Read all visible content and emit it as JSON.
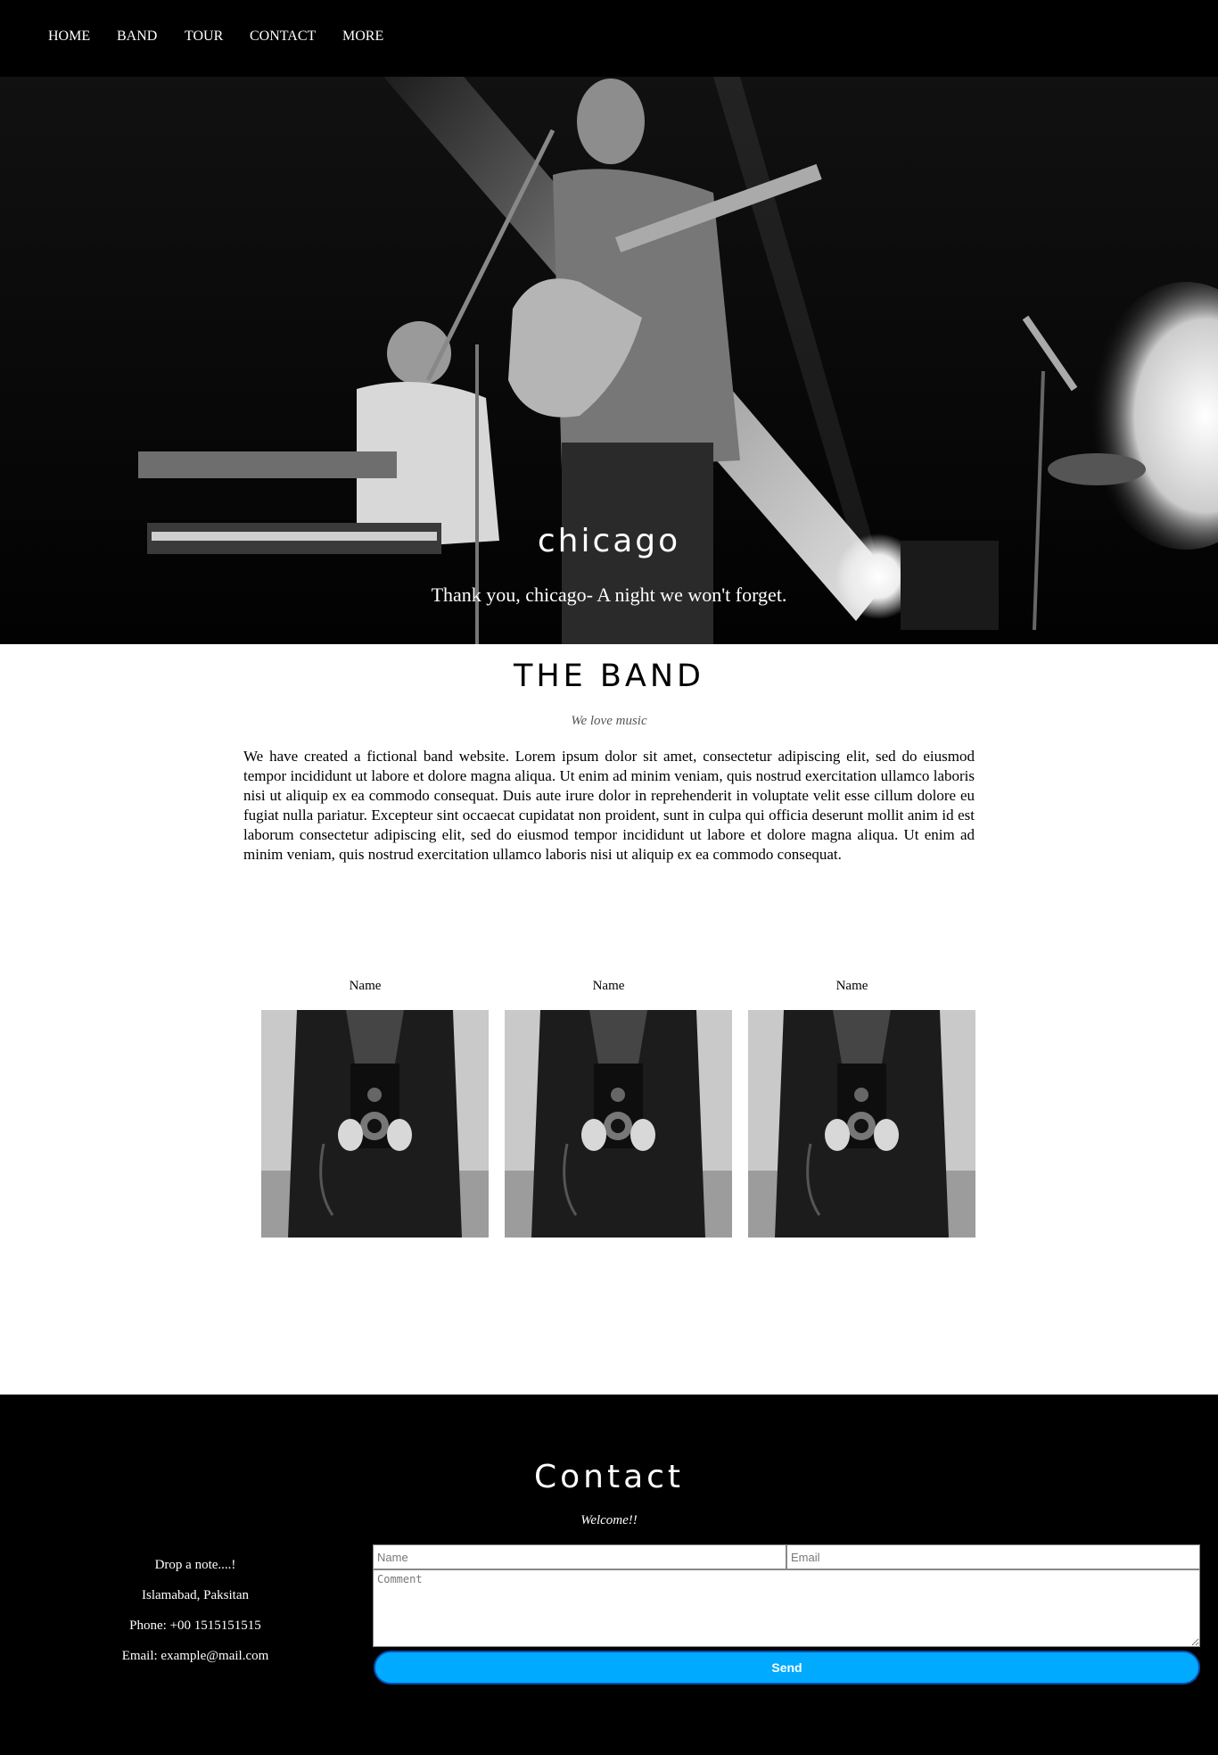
{
  "nav": {
    "items": [
      "HOME",
      "BAND",
      "TOUR",
      "CONTACT",
      "MORE"
    ]
  },
  "hero": {
    "title": "chicago",
    "subtitle": "Thank you, chicago- A night we won't forget."
  },
  "band": {
    "title": "THE BAND",
    "tagline": "We love music",
    "description": "We have created a fictional band website. Lorem ipsum dolor sit amet, consectetur adipiscing elit, sed do eiusmod tempor incididunt ut labore et dolore magna aliqua. Ut enim ad minim veniam, quis nostrud exercitation ullamco laboris nisi ut aliquip ex ea commodo consequat. Duis aute irure dolor in reprehenderit in voluptate velit esse cillum dolore eu fugiat nulla pariatur. Excepteur sint occaecat cupidatat non proident, sunt in culpa qui officia deserunt mollit anim id est laborum consectetur adipiscing elit, sed do eiusmod tempor incididunt ut labore et dolore magna aliqua. Ut enim ad minim veniam, quis nostrud exercitation ullamco laboris nisi ut aliquip ex ea commodo consequat.",
    "members": [
      {
        "name": "Name"
      },
      {
        "name": "Name"
      },
      {
        "name": "Name"
      }
    ]
  },
  "contact": {
    "title": "Contact",
    "welcome": "Welcome!!",
    "note": "Drop a note....!",
    "location": "Islamabad, Paksitan",
    "phone": "Phone: +00 1515151515",
    "email": "Email: example@mail.com",
    "form": {
      "name_placeholder": "Name",
      "email_placeholder": "Email",
      "comment_placeholder": "Comment",
      "send_label": "Send"
    }
  },
  "colors": {
    "nav_bg": "#000000",
    "contact_bg": "#000000",
    "send_button": "#00aaff"
  }
}
